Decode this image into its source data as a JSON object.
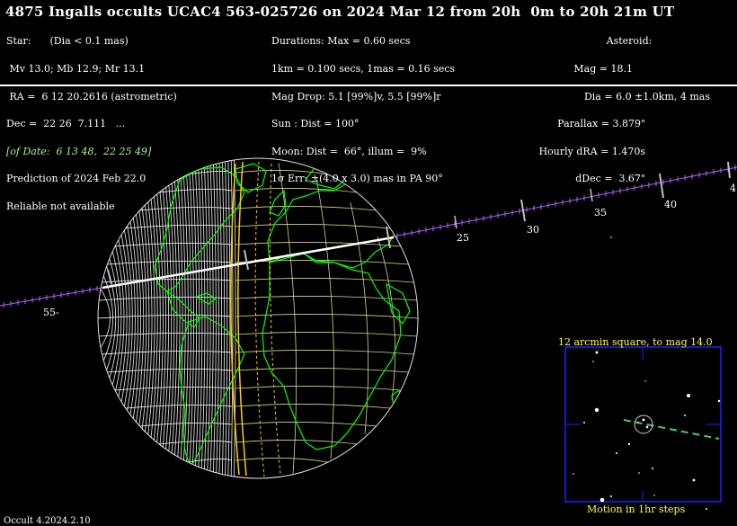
{
  "title": "4875 Ingalls occults UCAC4 563-025726 on 2024 Mar 12 from 20h  0m to 20h 21m UT",
  "star_block": [
    "Star:      (Dia < 0.1 mas)",
    " Mv 13.0; Mb 12.9; Mr 13.1",
    " RA =  6 12 20.2616 (astrometric)",
    "Dec =  22 26  7.111   ...",
    "[of Date:  6 13 48,  22 25 49]",
    "Prediction of 2024 Feb 22.0",
    "Reliable not available"
  ],
  "event_block": [
    "Durations: Max = 0.60 secs",
    "1km = 0.100 secs, 1mas = 0.16 secs",
    "Mag Drop: 5.1 [99%]v, 5.5 [99%]r",
    "Sun : Dist = 100°",
    "Moon: Dist =  66°, illum =  9%",
    "1σ Err: ±(4.0 x 3.0) mas in PA 90°"
  ],
  "asteroid_block": [
    "Asteroid:",
    "Mag = 18.1",
    "Dia = 6.0 ±1.0km, 4 mas",
    "Parallax = 3.879\"",
    "Hourly dRA = 1.470s",
    "dDec =  3.67\""
  ],
  "track_labels": [
    "55-",
    "25",
    "30",
    "35",
    "40",
    "4"
  ],
  "inset": {
    "title": "12 arcmin square, to mag 14.0",
    "footer": "Motion in 1hr steps"
  },
  "footer": "Occult 4.2024.2.10",
  "colors": {
    "grid": "#d8d880",
    "coast": "#00ff00",
    "night_lines": "#ffffff",
    "sunrise_line": "#ffcc00",
    "track": "#b060ff",
    "inset_text": "#ffff3a",
    "inset_border": "#2020ff",
    "motion": "#40d060"
  }
}
